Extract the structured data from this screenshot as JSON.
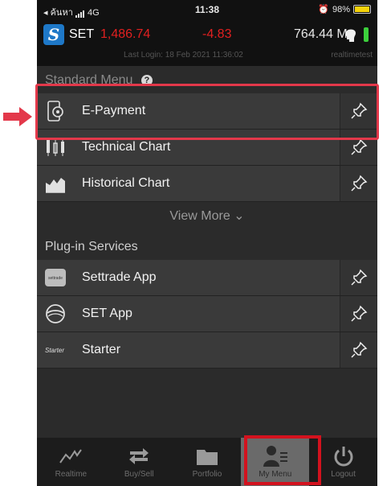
{
  "status_bar": {
    "carrier": "◂ ค้นหา",
    "network": "4G",
    "time": "11:38",
    "battery": "98%",
    "battery_level": 0.98
  },
  "header": {
    "index_name": "SET",
    "index_value": "1,486.74",
    "index_change": "-4.83",
    "volume": "764.44 M",
    "last_login": "Last Login: 18 Feb 2021 11:36:02",
    "mode_label": "realtimetest"
  },
  "standard_menu": {
    "title": "Standard Menu",
    "help": "?",
    "items": [
      {
        "label": "E-Payment",
        "icon": "e-payment-icon"
      },
      {
        "label": "Technical Chart",
        "icon": "technical-chart-icon"
      },
      {
        "label": "Historical Chart",
        "icon": "historical-chart-icon"
      }
    ],
    "view_more": "View More ⌄"
  },
  "plugin_services": {
    "title": "Plug-in Services",
    "items": [
      {
        "label": "Settrade App",
        "icon": "settrade-app-icon",
        "icon_text": "settrade"
      },
      {
        "label": "SET App",
        "icon": "set-app-icon"
      },
      {
        "label": "Starter",
        "icon": "starter-icon",
        "icon_text": "Starter"
      }
    ]
  },
  "tabs": [
    {
      "label": "Realtime",
      "icon": "realtime-icon"
    },
    {
      "label": "Buy/Sell",
      "icon": "buy-sell-icon"
    },
    {
      "label": "Portfolio",
      "icon": "portfolio-icon"
    },
    {
      "label": "My Menu",
      "icon": "my-menu-icon",
      "active": true
    },
    {
      "label": "Logout",
      "icon": "logout-icon"
    }
  ],
  "colors": {
    "accent_red": "#e02020",
    "highlight": "#e3384a",
    "background": "#2b2b2b"
  }
}
